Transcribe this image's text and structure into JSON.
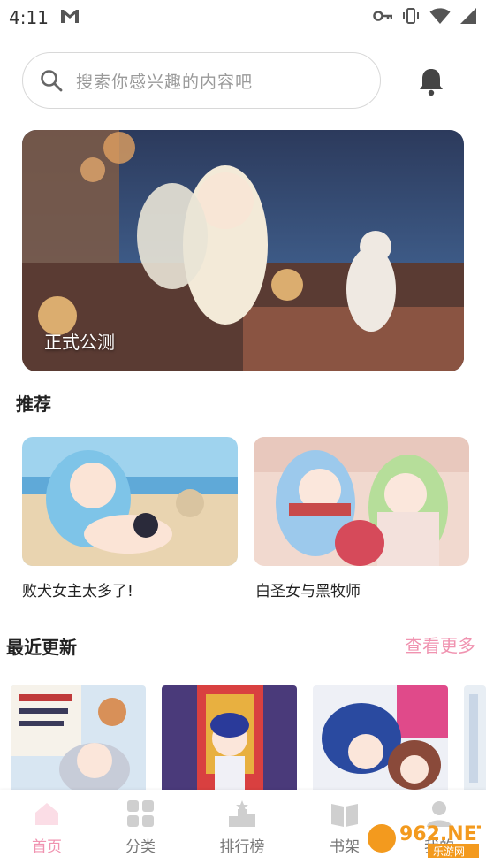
{
  "status_bar": {
    "time": "4:11"
  },
  "search": {
    "placeholder": "搜索你感兴趣的内容吧"
  },
  "banner": {
    "label": "正式公测"
  },
  "recommend": {
    "title": "推荐",
    "items": [
      {
        "title": "败犬女主太多了!"
      },
      {
        "title": "白圣女与黑牧师"
      }
    ]
  },
  "recent": {
    "title": "最近更新",
    "more_label": "查看更多"
  },
  "bottom_nav": {
    "items": [
      {
        "label": "首页",
        "icon": "home-icon"
      },
      {
        "label": "分类",
        "icon": "category-icon"
      },
      {
        "label": "排行榜",
        "icon": "ranking-icon"
      },
      {
        "label": "书架",
        "icon": "bookshelf-icon"
      },
      {
        "label": "我的",
        "icon": "profile-icon"
      }
    ],
    "active_color": "#f093b0"
  },
  "watermark": {
    "text": "962.NET",
    "sub": "乐游网"
  }
}
